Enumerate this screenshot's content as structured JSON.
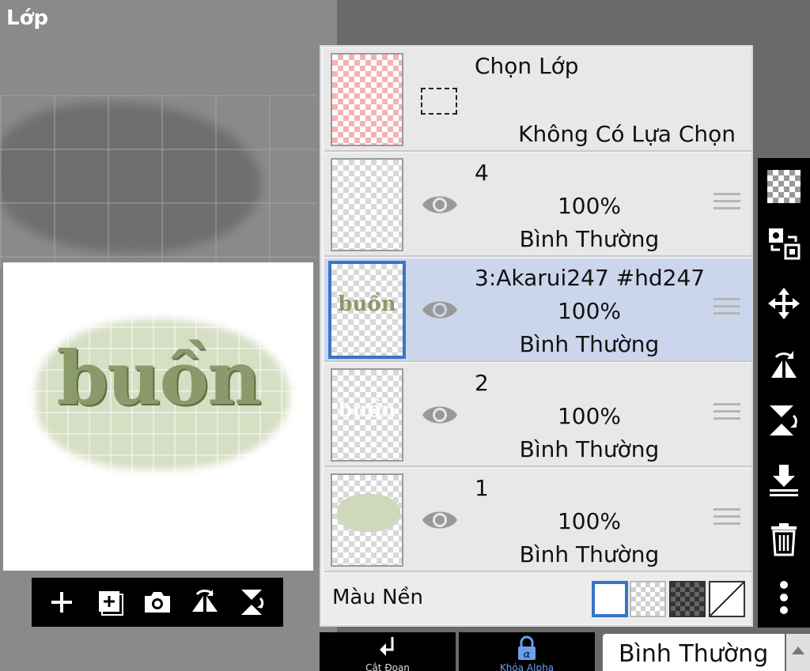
{
  "screen_title": "Lớp",
  "preview": {
    "art_text": "buồn"
  },
  "layers_panel": {
    "selection": {
      "title": "Chọn Lớp",
      "status": "Không Có Lựa Chọn"
    },
    "layers": [
      {
        "name": "4",
        "opacity": "100%",
        "blend": "Bình Thường",
        "selected": false,
        "thumb_text": ""
      },
      {
        "name": "3:Akarui247  #hd247",
        "opacity": "100%",
        "blend": "Bình Thường",
        "selected": true,
        "thumb_text": "buồn"
      },
      {
        "name": "2",
        "opacity": "100%",
        "blend": "Bình Thường",
        "selected": false,
        "thumb_text": "buồn"
      },
      {
        "name": "1",
        "opacity": "100%",
        "blend": "Bình Thường",
        "selected": false,
        "thumb_text": ""
      }
    ],
    "background_color": {
      "label": "Màu Nền",
      "options": [
        "white",
        "transparent",
        "dark-checker",
        "none"
      ],
      "selected": "white"
    }
  },
  "bottom_bar": {
    "clip_label": "Cắt Đoạn",
    "alpha_lock_label": "Khóa Alpha",
    "blend_mode": "Bình Thường"
  },
  "colors": {
    "selected_row": "#cbd6ec",
    "accent_blue": "#3a74c8",
    "toolbar_bg": "#000000"
  },
  "icons": {
    "layer_tools": [
      "add-layer-icon",
      "add-layer-copy-icon",
      "camera-icon",
      "flip-horizontal-icon",
      "flip-vertical-icon"
    ],
    "right_toolbar": [
      "checker-icon",
      "transform-icon",
      "move-icon",
      "flip-rotate-icon",
      "flip-vertical-rotate-icon",
      "merge-down-icon",
      "trash-icon",
      "more-icon"
    ]
  }
}
